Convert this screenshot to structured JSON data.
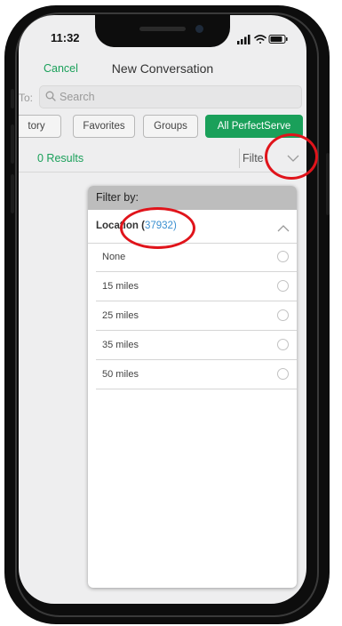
{
  "status_bar": {
    "time": "11:32"
  },
  "nav": {
    "cancel_label": "Cancel",
    "title": "New Conversation"
  },
  "to_field": {
    "label": "To:",
    "placeholder": "Search"
  },
  "segments": {
    "items": [
      {
        "label": "tory"
      },
      {
        "label": "Favorites"
      },
      {
        "label": "Groups"
      },
      {
        "label": "All PerfectServe"
      }
    ],
    "active_index": 3
  },
  "results": {
    "text": "0 Results",
    "filter_label": "Filte"
  },
  "filter_sheet": {
    "header": "Filter by:",
    "location_label": "Location (",
    "location_code": "37932",
    "location_close": ")",
    "options": [
      {
        "label": "None"
      },
      {
        "label": "15 miles"
      },
      {
        "label": "25 miles"
      },
      {
        "label": "35 miles"
      },
      {
        "label": "50 miles"
      }
    ]
  },
  "colors": {
    "accent": "#1aa05a",
    "link_blue": "#3a8fd0",
    "annotation_red": "#e0141b"
  },
  "icons": [
    "search-icon",
    "chevron-down-icon",
    "chevron-up-icon",
    "signal-icon",
    "wifi-icon",
    "battery-icon"
  ]
}
